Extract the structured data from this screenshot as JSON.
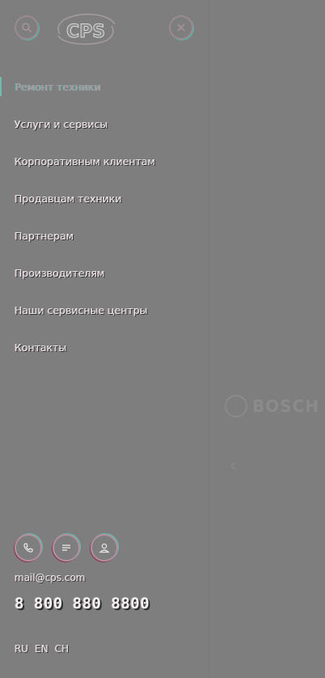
{
  "header": {
    "logo_text": "CPS",
    "left_icon": "search-icon",
    "right_icon": "close-icon"
  },
  "menu": {
    "items": [
      {
        "label": "Ремонт техники",
        "active": true
      },
      {
        "label": "Услуги и сервисы"
      },
      {
        "label": "Корпоративным клиентам"
      },
      {
        "label": "Продавцам техники"
      },
      {
        "label": "Партнерам"
      },
      {
        "label": "Производителям"
      },
      {
        "label": "Наши сервисные центры"
      },
      {
        "label": "Контакты"
      }
    ]
  },
  "contacts": {
    "icons": [
      "phone-icon",
      "chat-icon",
      "user-icon"
    ],
    "email": "mail@cps.com",
    "phone": "8 800 880 8800"
  },
  "languages": [
    "RU",
    "EN",
    "CH"
  ],
  "background": {
    "brand": "BOSCH"
  },
  "colors": {
    "overlay": "#7e7e7e",
    "accent_teal": "#6fb9ad",
    "accent_pink": "#b38fa0",
    "text": "#e9e9e9"
  }
}
